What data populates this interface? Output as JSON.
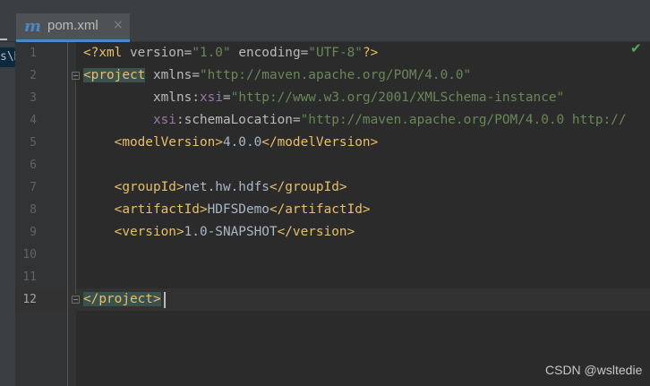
{
  "tab": {
    "icon": "m",
    "icon_name": "maven-icon",
    "label": "pom.xml",
    "close": "×"
  },
  "sidebar": {
    "path_fragment": "s\\H"
  },
  "gutter": {
    "line_numbers": [
      "1",
      "2",
      "3",
      "4",
      "5",
      "6",
      "7",
      "8",
      "9",
      "10",
      "11",
      "12"
    ],
    "current_line": "12"
  },
  "code": {
    "l1": {
      "start": "<?xml ",
      "version_attr": "version",
      "eq1": "=",
      "version_val": "\"1.0\"",
      "sp": " ",
      "encoding_attr": "encoding",
      "eq2": "=",
      "encoding_val": "\"UTF-8\"",
      "end": "?>"
    },
    "l2": {
      "open": "<project",
      "sp": " ",
      "attr": "xmlns",
      "eq": "=",
      "val": "\"http://maven.apache.org/POM/4.0.0\""
    },
    "l3": {
      "indent": "         ",
      "prefix": "xmlns",
      "colon": ":",
      "ns": "xsi",
      "eq": "=",
      "val": "\"http://www.w3.org/2001/XMLSchema-instance\""
    },
    "l4": {
      "indent": "         ",
      "ns": "xsi",
      "colon": ":",
      "attr": "schemaLocation",
      "eq": "=",
      "val": "\"http://maven.apache.org/POM/4.0.0 http://"
    },
    "l5": {
      "indent": "    ",
      "open": "<modelVersion>",
      "text": "4.0.0",
      "close": "</modelVersion>"
    },
    "l7": {
      "indent": "    ",
      "open": "<groupId>",
      "text": "net.hw.hdfs",
      "close": "</groupId>"
    },
    "l8": {
      "indent": "    ",
      "open": "<artifactId>",
      "text": "HDFSDemo",
      "close": "</artifactId>"
    },
    "l9": {
      "indent": "    ",
      "open": "<version>",
      "text": "1.0-SNAPSHOT",
      "close": "</version>"
    },
    "l12": {
      "close": "</project>"
    }
  },
  "status": {
    "inspection": "✔",
    "inspection_icon": "check-icon"
  },
  "watermark": "CSDN @wsltedie",
  "colors": {
    "tag": "#e8bf6a",
    "string": "#6a8759",
    "namespace": "#9876aa",
    "background": "#2b2b2b",
    "accent": "#4a88c7"
  }
}
